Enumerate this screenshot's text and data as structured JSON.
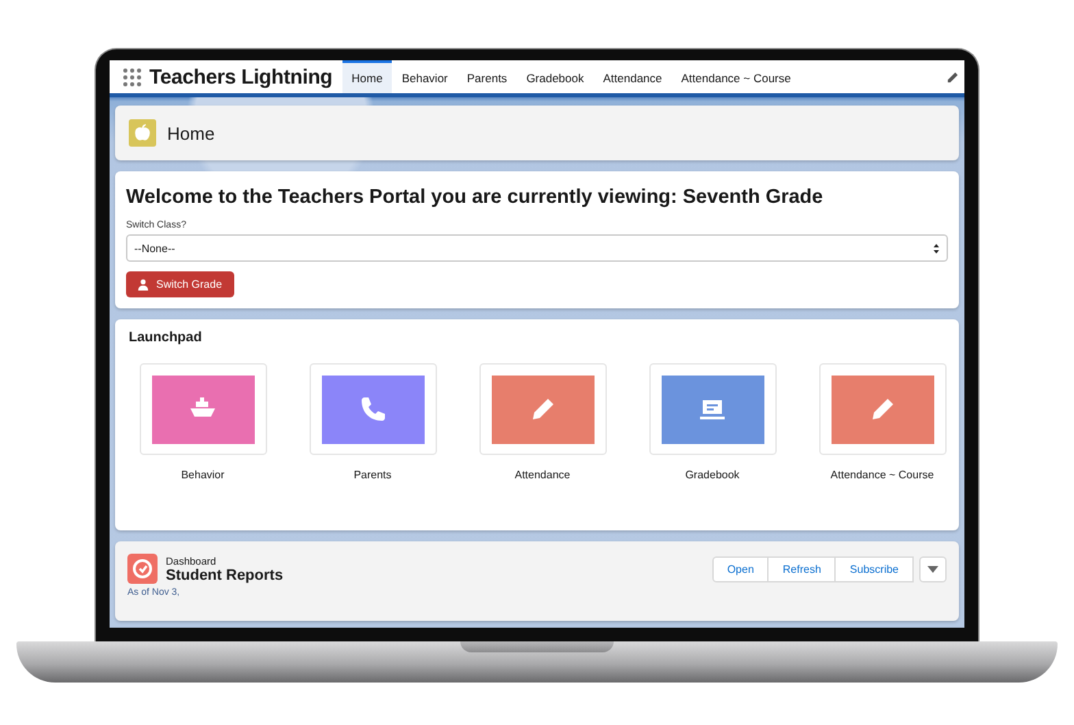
{
  "app": {
    "title": "Teachers Lightning"
  },
  "nav_tabs": [
    {
      "label": "Home",
      "selected": true
    },
    {
      "label": "Behavior",
      "selected": false
    },
    {
      "label": "Parents",
      "selected": false
    },
    {
      "label": "Gradebook",
      "selected": false
    },
    {
      "label": "Attendance",
      "selected": false
    },
    {
      "label": "Attendance ~ Course",
      "selected": false
    }
  ],
  "page_header": {
    "title": "Home"
  },
  "welcome": {
    "heading": "Welcome to the Teachers Portal you are currently viewing: Seventh Grade",
    "field_label": "Switch Class?",
    "select_value": "--None--",
    "button": "Switch Grade"
  },
  "launchpad": {
    "title": "Launchpad",
    "items": [
      {
        "label": "Behavior",
        "color": "#e96fb0"
      },
      {
        "label": "Parents",
        "color": "#8b85f9"
      },
      {
        "label": "Attendance",
        "color": "#e77e6c"
      },
      {
        "label": "Gradebook",
        "color": "#6b93dd"
      },
      {
        "label": "Attendance ~ Course",
        "color": "#e77e6c"
      }
    ]
  },
  "dashboard": {
    "overline": "Dashboard",
    "title": "Student Reports",
    "subtitle": "As of Nov 3,",
    "buttons": [
      "Open",
      "Refresh",
      "Subscribe"
    ]
  }
}
